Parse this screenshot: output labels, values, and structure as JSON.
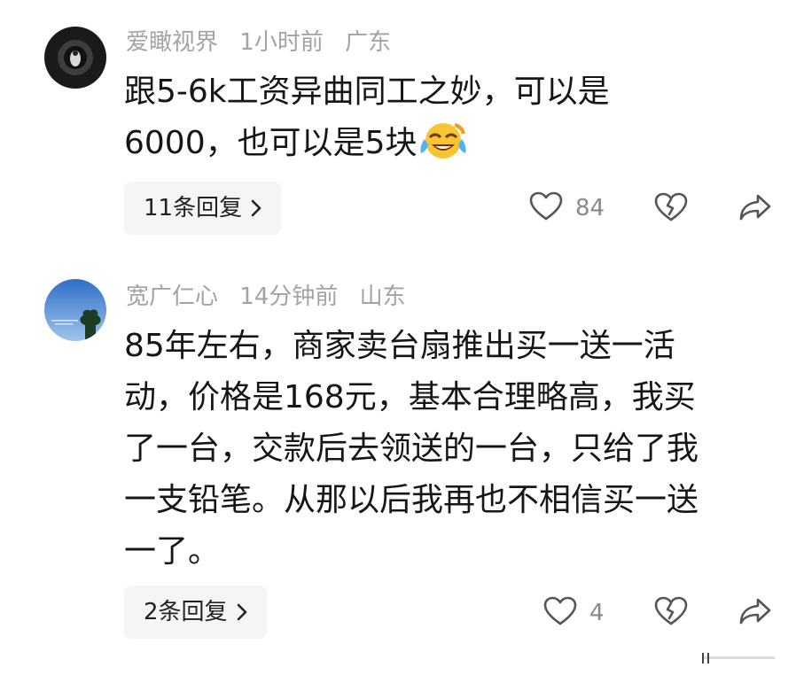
{
  "comments": [
    {
      "username": "爱瞰视界",
      "time": "1小时前",
      "location": "广东",
      "lines": [
        "跟5-6k工资异曲同工之妙，可以是",
        "6000，也可以是5块"
      ],
      "emoji_icon": "laughing-crying-emoji-icon",
      "reply_label": "11条回复",
      "like_count": "84"
    },
    {
      "username": "宽广仁心",
      "time": "14分钟前",
      "location": "山东",
      "lines": [
        "85年左右，商家卖台扇推出买一送一活",
        "动，价格是168元，基本合理略高，我买",
        "了一台，交款后去领送的一台，只给了我",
        "一支铅笔。从那以后我再也不相信买一送",
        "一了。"
      ],
      "reply_label": "2条回复",
      "like_count": "4"
    }
  ],
  "icons": {
    "like": "heart-outline-icon",
    "dislike": "broken-heart-icon",
    "share": "share-arrow-icon",
    "reply_chevron": "chevron-right-icon"
  },
  "colors": {
    "meta_text": "#a3a3a3",
    "body_text": "#161616",
    "reply_bg": "#f5f5f5",
    "icon_stroke": "#555555"
  }
}
